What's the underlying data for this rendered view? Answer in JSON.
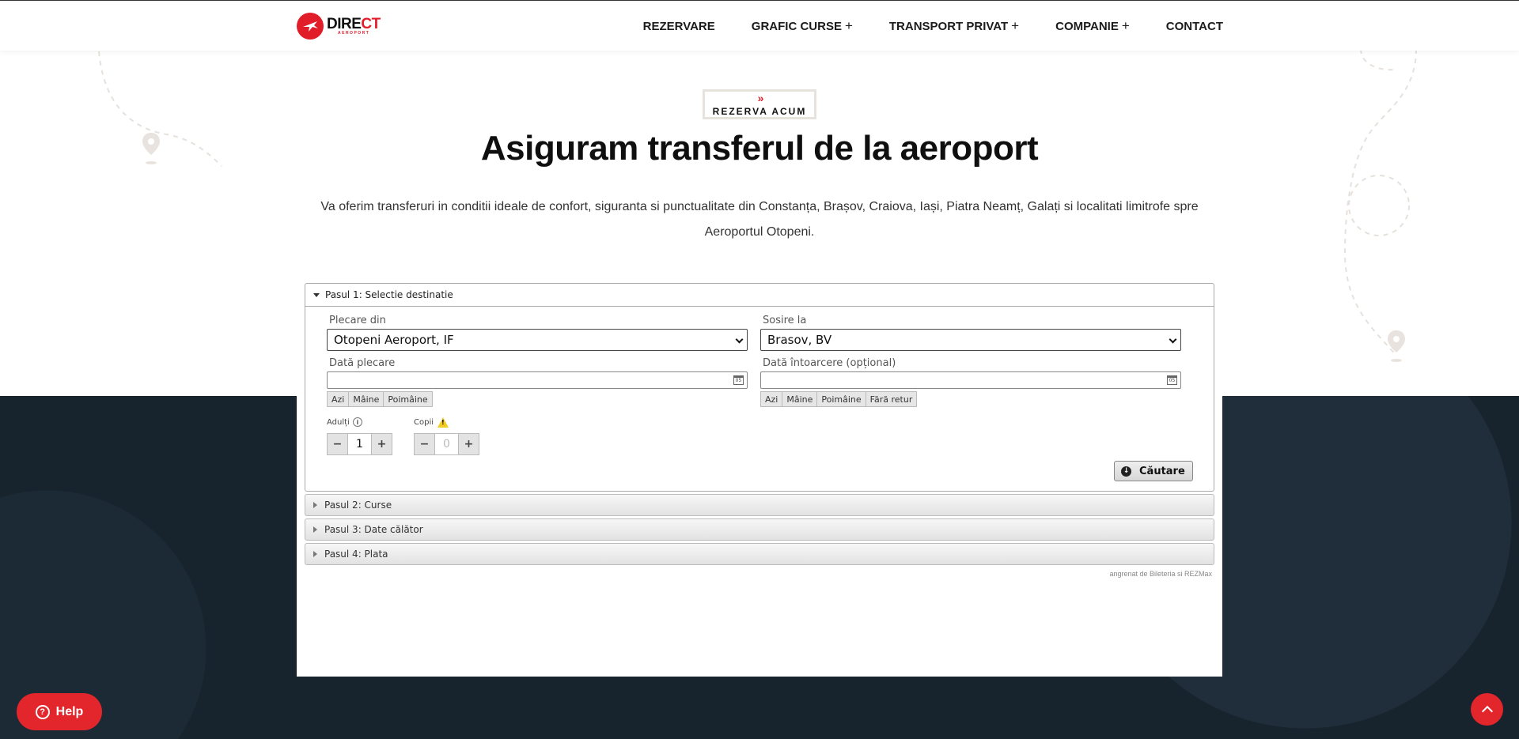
{
  "header": {
    "logo_text_main": "DIRE",
    "logo_text_accent": "CT",
    "logo_text_sub": "AEROPORT",
    "nav": [
      {
        "label": "REZERVARE",
        "has_submenu": false
      },
      {
        "label": "GRAFIC CURSE",
        "has_submenu": true
      },
      {
        "label": "TRANSPORT PRIVAT",
        "has_submenu": true
      },
      {
        "label": "COMPANIE",
        "has_submenu": true
      },
      {
        "label": "CONTACT",
        "has_submenu": false
      }
    ],
    "submenu_symbol": "+"
  },
  "hero": {
    "badge": "REZERVA ACUM",
    "badge_icon": "»",
    "title": "Asiguram transferul de la aeroport",
    "description": "Va oferim transferuri in conditii ideale de confort, siguranta si punctualitate din Constanța, Brașov, Craiova, Iași, Piatra Neamț, Galați si localitati limitrofe spre Aeroportul Otopeni."
  },
  "booking": {
    "step1": {
      "title": "Pasul 1: Selectie destinatie",
      "departure_label": "Plecare din",
      "departure_value": "Otopeni Aeroport, IF",
      "arrival_label": "Sosire la",
      "arrival_value": "Brasov, BV",
      "depart_date_label": "Dată plecare",
      "return_date_label": "Dată întoarcere (opțional)",
      "depart_quick": [
        "Azi",
        "Mâine",
        "Poimâine"
      ],
      "return_quick": [
        "Azi",
        "Mâine",
        "Poimâine",
        "Fără retur"
      ],
      "adults_label": "Adulți",
      "adults_value": "1",
      "children_label": "Copii",
      "children_value": "0",
      "search_label": "Căutare"
    },
    "steps_collapsed": [
      "Pasul 2: Curse",
      "Pasul 3: Date călător",
      "Pasul 4: Plata"
    ],
    "powered_by": "angrenat de Bileteria si REZMax"
  },
  "floating": {
    "help_label": "Help",
    "help_icon": "?"
  },
  "colors": {
    "brand_red": "#e3262c",
    "dark_bg": "#17232d"
  }
}
